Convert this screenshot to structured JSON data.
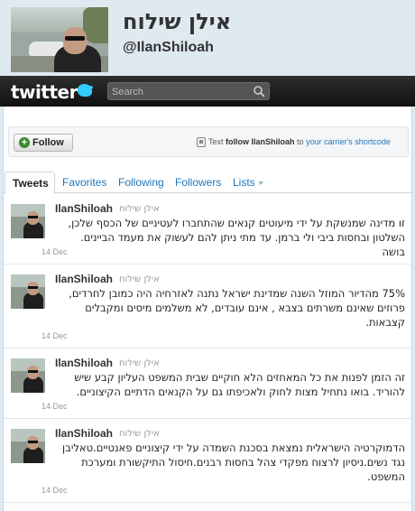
{
  "profile": {
    "name": "אילן שילוח",
    "handle": "@IlanShiloah"
  },
  "topbar": {
    "logo": "twitter",
    "search_placeholder": "Search"
  },
  "follow": {
    "button_label": "Follow",
    "sms_prefix": "Text",
    "sms_command": "follow IlanShiloah",
    "sms_middle": "to",
    "sms_link": "your carrier's shortcode"
  },
  "tabs": [
    {
      "label": "Tweets",
      "active": true
    },
    {
      "label": "Favorites"
    },
    {
      "label": "Following"
    },
    {
      "label": "Followers"
    },
    {
      "label": "Lists"
    }
  ],
  "tweets": [
    {
      "user": "IlanShiloah",
      "fullname": "אילן שילוח",
      "text": "זו מדינה שמנשקת על ידי מיעוטים קנאים שהתחברו לעטיניים של הכסף שלכן, השלטון ובחסות ביבי ולי ברמן. עד מתי ניתן להם לעשוק את מעמד הביינים. בושה",
      "date": "14 Dec"
    },
    {
      "user": "IlanShiloah",
      "fullname": "אילן שילוח",
      "text": "75% מהדיור המוזל השנה שמדינת ישראל נתנה לאזרחיה היה כמובן לחרדים, פרוזים שאינם משרתים בצבא , אינם עובדים, לא משלמים מיסים ומקבלים קצבאות.",
      "date": "14 Dec"
    },
    {
      "user": "IlanShiloah",
      "fullname": "אילן שילוח",
      "text": "זה הזמן לפנות את כל המאחזים הלא חוקיים שבית המשפט העליון קבע שיש להוריד. בואו נתחיל מצות לחוק ולאכיפתו גם על הקנאים הדתיים הקיצוניים.",
      "date": "14 Dec"
    },
    {
      "user": "IlanShiloah",
      "fullname": "אילן שילוח",
      "text": "הדמוקרטיה הישראלית נמצאת בסכנת השמדה על ידי קיצוניים פאנטיים.טאליבן נגד נשים.ניסיון לרצוח מפקדי צהל בחסות רבנים.חיסול התיקשורת ומערכת המשפט.",
      "date": "14 Dec"
    }
  ]
}
